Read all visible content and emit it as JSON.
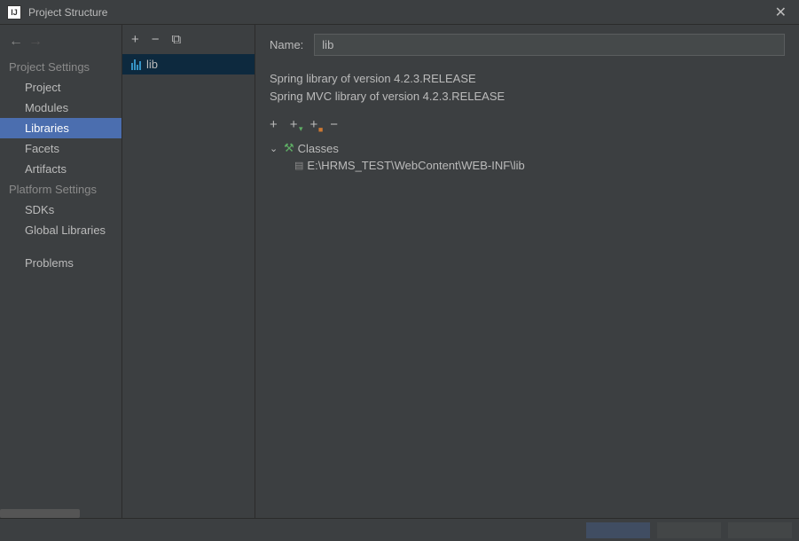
{
  "titlebar": {
    "title": "Project Structure"
  },
  "sidebar": {
    "section1": "Project Settings",
    "items1": [
      "Project",
      "Modules",
      "Libraries",
      "Facets",
      "Artifacts"
    ],
    "section2": "Platform Settings",
    "items2": [
      "SDKs",
      "Global Libraries"
    ],
    "problems": "Problems"
  },
  "middle": {
    "lib_name": "lib"
  },
  "detail": {
    "name_label": "Name:",
    "name_value": "lib",
    "info1": "Spring library of version 4.2.3.RELEASE",
    "info2": "Spring MVC library of version 4.2.3.RELEASE",
    "tree": {
      "classes": "Classes",
      "path": "E:\\HRMS_TEST\\WebContent\\WEB-INF\\lib"
    }
  }
}
